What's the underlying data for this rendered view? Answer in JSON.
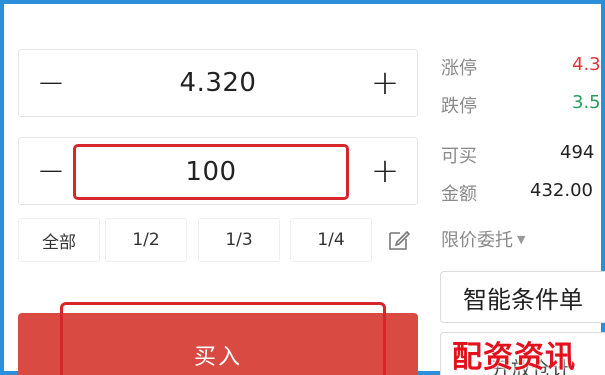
{
  "price": {
    "minus": "−",
    "value": "4.320",
    "plus": "+"
  },
  "quantity": {
    "minus": "−",
    "value": "100",
    "plus": "+"
  },
  "fractions": [
    "全部",
    "1/2",
    "1/3",
    "1/4"
  ],
  "info": {
    "limit_up_label": "涨停",
    "limit_up_value": "4.3",
    "limit_down_label": "跌停",
    "limit_down_value": "3.5",
    "can_buy_label": "可买",
    "can_buy_value": "494",
    "amount_label": "金额",
    "amount_value": "432.00"
  },
  "order_type": "限价委托",
  "smart_order_label": "智能条件单",
  "lower_button_label": "开放仓计",
  "buy_label": "买入",
  "watermark": "配资资讯",
  "colors": {
    "up": "#e0353b",
    "down": "#2a9d5c",
    "buy": "#d94a43",
    "highlight": "#d6252b",
    "frame": "#2b8fd9"
  }
}
